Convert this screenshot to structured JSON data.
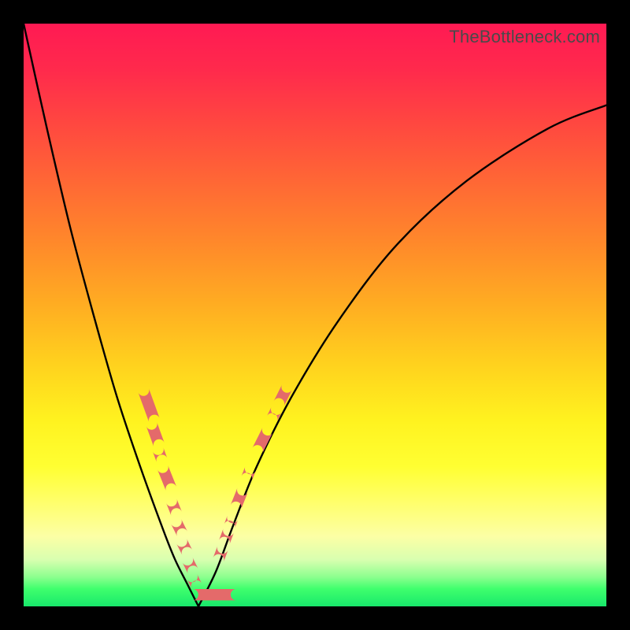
{
  "watermark": "TheBottleneck.com",
  "colors": {
    "curve": "#000000",
    "marker": "#e46a6a",
    "frame": "#000000"
  },
  "chart_data": {
    "type": "line",
    "title": "",
    "xlabel": "",
    "ylabel": "",
    "xlim": [
      0,
      100
    ],
    "ylim": [
      0,
      100
    ],
    "grid": false,
    "legend": false,
    "series": [
      {
        "name": "left-branch",
        "x": [
          0,
          4,
          8,
          12,
          16,
          20,
          24,
          26,
          28,
          30
        ],
        "y": [
          100,
          82,
          65,
          50,
          36,
          24,
          13,
          8,
          4,
          0
        ]
      },
      {
        "name": "right-branch",
        "x": [
          30,
          33,
          36,
          40,
          46,
          54,
          64,
          76,
          90,
          100
        ],
        "y": [
          0,
          6,
          14,
          24,
          36,
          49,
          62,
          73,
          82,
          86
        ]
      }
    ],
    "markers_left": [
      {
        "x": 21.5,
        "y": 34.5,
        "len": 5.5
      },
      {
        "x": 22.6,
        "y": 29.5,
        "len": 3.8
      },
      {
        "x": 23.4,
        "y": 26.0,
        "len": 2.0
      },
      {
        "x": 24.6,
        "y": 22.0,
        "len": 4.0
      },
      {
        "x": 25.8,
        "y": 17.0,
        "len": 2.4
      },
      {
        "x": 26.7,
        "y": 13.5,
        "len": 2.4
      },
      {
        "x": 27.6,
        "y": 10.2,
        "len": 2.2
      },
      {
        "x": 28.6,
        "y": 7.0,
        "len": 2.2
      },
      {
        "x": 29.3,
        "y": 4.3,
        "len": 1.8
      }
    ],
    "markers_bottom": [
      {
        "x": 29.0,
        "y": 2.0,
        "w": 7.5
      }
    ],
    "markers_right": [
      {
        "x": 33.8,
        "y": 9.0,
        "len": 2.2
      },
      {
        "x": 34.8,
        "y": 12.0,
        "len": 2.2
      },
      {
        "x": 35.6,
        "y": 14.5,
        "len": 1.6
      },
      {
        "x": 37.0,
        "y": 18.5,
        "len": 3.2
      },
      {
        "x": 38.6,
        "y": 22.8,
        "len": 1.8
      },
      {
        "x": 41.0,
        "y": 28.5,
        "len": 4.0
      },
      {
        "x": 43.0,
        "y": 33.0,
        "len": 1.8
      },
      {
        "x": 44.5,
        "y": 36.2,
        "len": 3.2
      }
    ]
  }
}
